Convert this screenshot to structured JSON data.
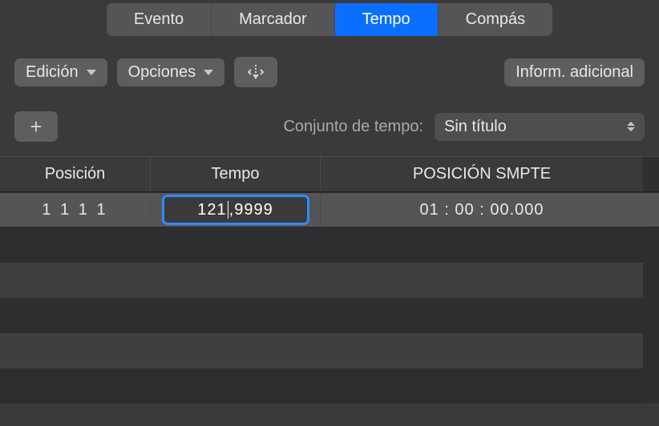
{
  "tabs": {
    "evento": "Evento",
    "marcador": "Marcador",
    "tempo": "Tempo",
    "compas": "Compás"
  },
  "toolbar": {
    "edicion": "Edición",
    "opciones": "Opciones",
    "inform": "Inform. adicional"
  },
  "set": {
    "label": "Conjunto de tempo:",
    "value": "Sin título"
  },
  "headers": {
    "posicion": "Posición",
    "tempo": "Tempo",
    "smpte": "POSICIÓN SMPTE"
  },
  "rows": [
    {
      "posicion": "1 1 1   1",
      "tempo_before": "121",
      "tempo_after": ",9999",
      "smpte": "01 : 00 : 00.000"
    }
  ]
}
